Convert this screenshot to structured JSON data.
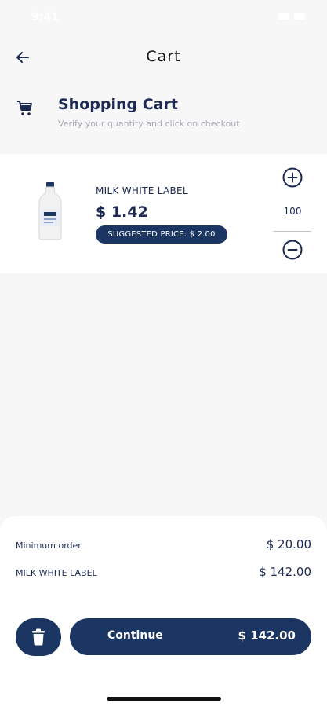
{
  "status_bar": {
    "time": "9:41"
  },
  "nav": {
    "title": "Cart"
  },
  "header": {
    "title": "Shopping Cart",
    "subtitle": "Verify your quantity and click on checkout"
  },
  "cart_items": [
    {
      "name": "MILK WHITE LABEL",
      "price": "$ 1.42",
      "suggested_price": "SUGGESTED PRICE: $ 2.00",
      "quantity": "100"
    }
  ],
  "summary": {
    "minimum_order_label": "Minimum order",
    "minimum_order_value": "$ 20.00",
    "item_label": "MILK WHITE LABEL",
    "item_total": "$ 142.00"
  },
  "actions": {
    "continue_label": "Continue",
    "continue_total": "$ 142.00"
  },
  "icons": {
    "back": "arrow-left-icon",
    "cart": "cart-icon",
    "plus": "plus-circle-icon",
    "minus": "minus-circle-icon",
    "delete": "trash-icon"
  },
  "colors": {
    "brand": "#1c3664",
    "text": "#1c2a52",
    "background": "#f7f7f7"
  }
}
